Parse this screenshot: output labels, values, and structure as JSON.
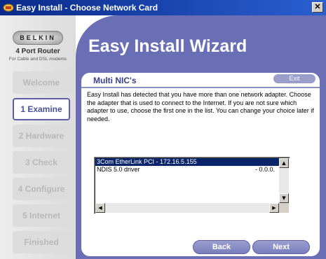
{
  "window": {
    "title": "Easy Install - Choose Network Card",
    "close_glyph": "✕"
  },
  "sidebar": {
    "logo_text": "BELKIN",
    "product_name": "4 Port Router",
    "product_sub": "For Cable and DSL modems",
    "steps": [
      {
        "label": "Welcome",
        "state": "disabled"
      },
      {
        "label": "1 Examine",
        "state": "active"
      },
      {
        "label": "2 Hardware",
        "state": "disabled"
      },
      {
        "label": "3 Check",
        "state": "disabled"
      },
      {
        "label": "4 Configure",
        "state": "disabled"
      },
      {
        "label": "5 Internet",
        "state": "disabled"
      },
      {
        "label": "Finished",
        "state": "disabled"
      }
    ]
  },
  "main": {
    "wizard_title": "Easy Install Wizard",
    "card": {
      "title": "Multi NIC's",
      "exit_label": "Exit",
      "description": "Easy Install has detected that you have more than one network adapter. Choose the adapter that is used to connect to the Internet. If you are not sure which adapter to use, choose the first one in the list. You can change your choice later if needed."
    },
    "adapter_list": [
      {
        "label": "3Com EtherLink PCI - 172.16.5.155",
        "right": "",
        "selected": true
      },
      {
        "label": "NDIS 5.0 driver",
        "right": "- 0.0.0.",
        "selected": false
      }
    ],
    "buttons": {
      "back": "Back",
      "next": "Next"
    }
  },
  "colors": {
    "title_bar": "#0a2a8a",
    "panel": "#6a6fb5",
    "accent": "#3a3f8c",
    "selection": "#0a246a"
  }
}
